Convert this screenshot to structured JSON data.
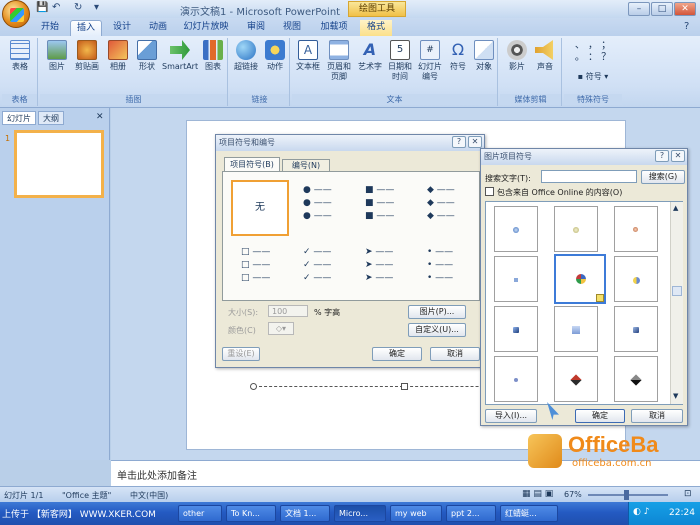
{
  "window": {
    "title": "演示文稿1 - Microsoft PowerPoint",
    "context_tab": "绘图工具",
    "controls": [
      "–",
      "□",
      "✕"
    ]
  },
  "tabs": [
    "开始",
    "插入",
    "设计",
    "动画",
    "幻灯片放映",
    "审阅",
    "视图",
    "加载项",
    "格式"
  ],
  "active_tab": "插入",
  "ribbon": {
    "groups": [
      {
        "label": "表格",
        "buttons": [
          "表格"
        ]
      },
      {
        "label": "插图",
        "buttons": [
          "图片",
          "剪贴画",
          "相册",
          "形状",
          "SmartArt",
          "图表"
        ]
      },
      {
        "label": "链接",
        "buttons": [
          "超链接",
          "动作"
        ]
      },
      {
        "label": "文本",
        "buttons": [
          "文本框",
          "页眉和页脚",
          "艺术字",
          "日期和时间",
          "幻灯片编号",
          "符号",
          "对象"
        ]
      },
      {
        "label": "媒体剪辑",
        "buttons": [
          "影片",
          "声音"
        ]
      },
      {
        "label": "特殊符号",
        "buttons": [
          "符号"
        ]
      }
    ]
  },
  "left_pane": {
    "tabs": [
      "幻灯片",
      "大纲"
    ],
    "close": "✕",
    "slide_number": "1"
  },
  "bullets_dialog": {
    "title": "项目符号和编号",
    "tabs": [
      "项目符号(B)",
      "编号(N)"
    ],
    "none_label": "无",
    "size_label": "大小(S):",
    "size_value": "100",
    "size_unit": "% 字高",
    "color_label": "颜色(C)",
    "picture_button": "图片(P)...",
    "custom_button": "自定义(U)...",
    "reset_button": "重设(E)",
    "ok_button": "确定",
    "cancel_button": "取消"
  },
  "picture_bullet_dialog": {
    "title": "图片项目符号",
    "search_label": "搜索文字(T):",
    "search_value": "",
    "search_button": "搜索(G)",
    "include_online": "包含来自 Office Online 的内容(O)",
    "import_button": "导入(I)...",
    "ok_button": "确定",
    "cancel_button": "取消"
  },
  "notes_placeholder": "单击此处添加备注",
  "status": {
    "slide": "幻灯片 1/1",
    "theme": "\"Office 主题\"",
    "language": "中文(中国)",
    "zoom": "67%"
  },
  "taskbar": {
    "items": [
      "other",
      "To Kn...",
      "文档 1...",
      "Micro...",
      "my web",
      "ppt 2...",
      "红蜻蜓..."
    ],
    "time": "22:24"
  },
  "watermark": {
    "brand": "OfficeBa",
    "url": "officeba.com.cn",
    "left_text": "上传于 【新客网】 WWW.XKER.COM"
  }
}
